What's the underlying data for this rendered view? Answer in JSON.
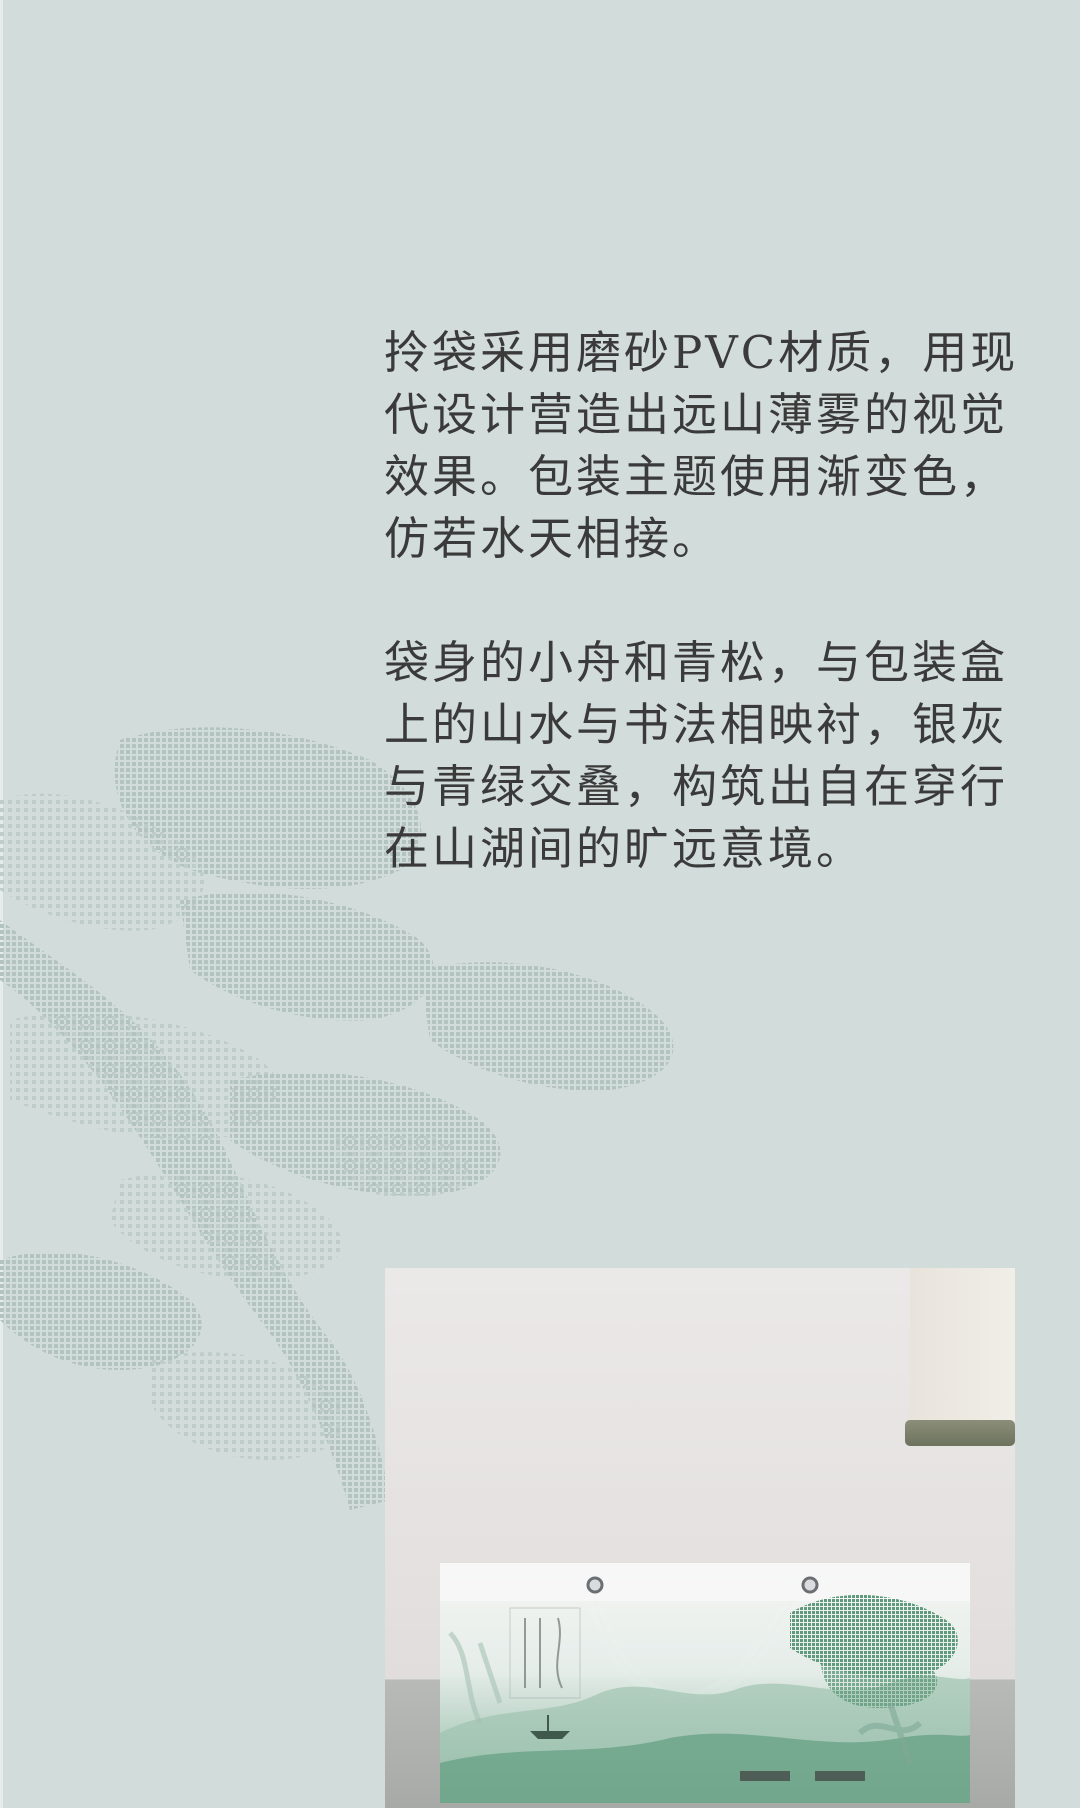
{
  "description_text": {
    "paragraph_1": "拎袋采用磨砂PVC材质，用现代设计营造出远山薄雾的视觉效果。包装主题使用渐变色，仿若水天相接。",
    "paragraph_2": "袋身的小舟和青松，与包装盒上的山水与书法相映衬，银灰与青绿交叠，构筑出自在穿行在山湖间的旷远意境。"
  },
  "colors": {
    "background": "#d2dcda",
    "pine_pattern": "#b3c3c0",
    "text": "#3a3a3a",
    "bag_green": "#5e9a7c"
  }
}
